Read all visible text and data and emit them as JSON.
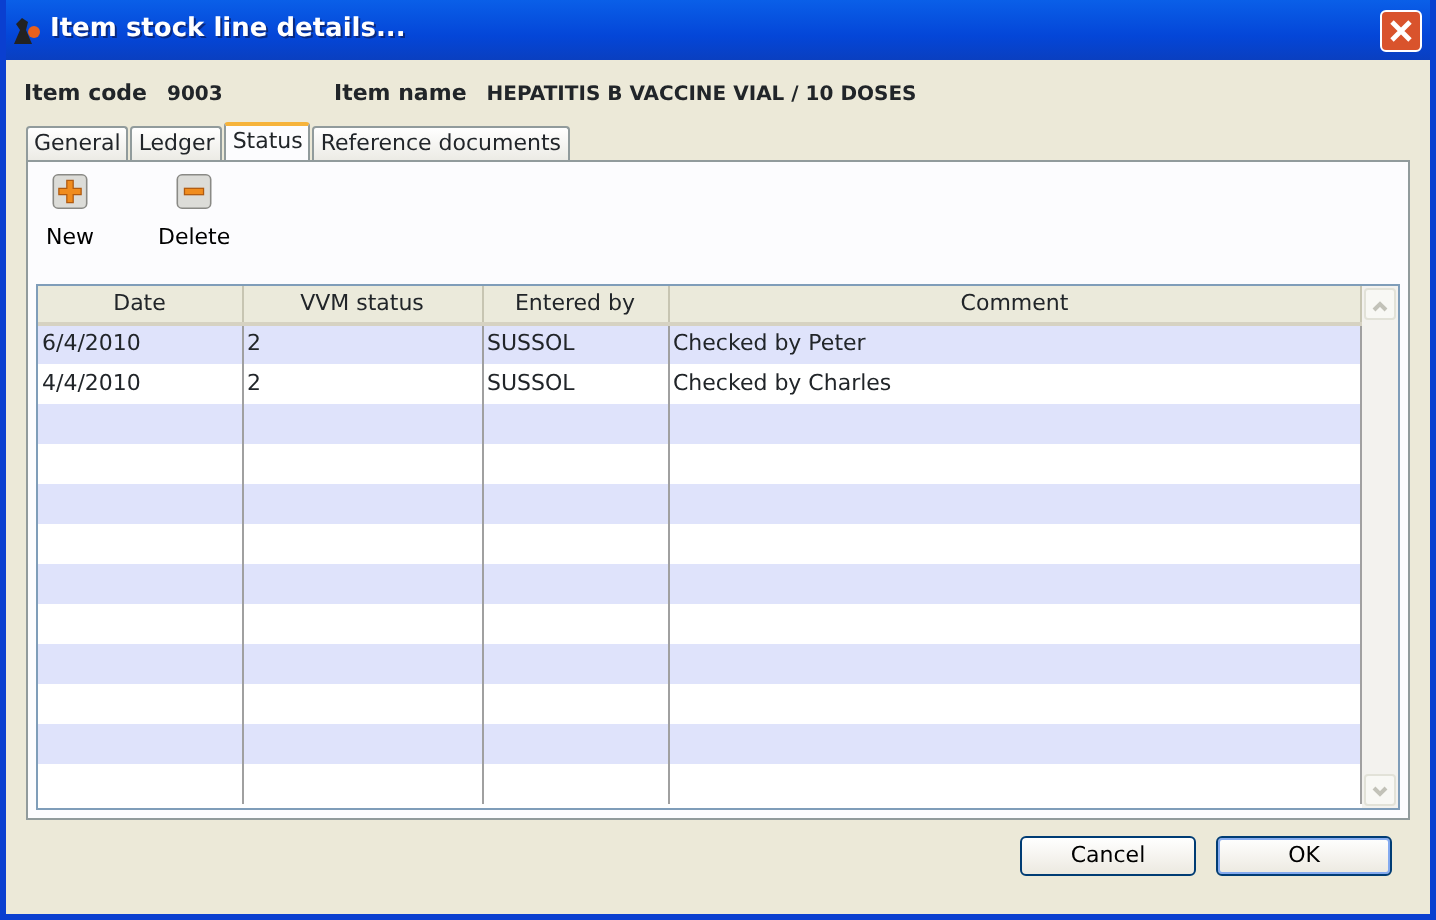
{
  "window": {
    "title": "Item stock line details..."
  },
  "fields": [
    {
      "label": "Item code",
      "value": "9003"
    },
    {
      "label": "Item name",
      "value": "HEPATITIS B VACCINE VIAL / 10 DOSES"
    }
  ],
  "tabs": [
    {
      "label": "General",
      "selected": false
    },
    {
      "label": "Ledger",
      "selected": false
    },
    {
      "label": "Status",
      "selected": true
    },
    {
      "label": "Reference documents",
      "selected": false
    }
  ],
  "toolbar": [
    {
      "kind": "add",
      "label": "New"
    },
    {
      "kind": "remove",
      "label": "Delete"
    }
  ],
  "table": {
    "columns": [
      "Date",
      "VVM status",
      "Entered by",
      "Comment"
    ],
    "rows": [
      [
        "6/4/2010",
        "2",
        "SUSSOL",
        "Checked by Peter"
      ],
      [
        "4/4/2010",
        "2",
        "SUSSOL",
        "Checked by Charles"
      ]
    ]
  },
  "buttons": [
    {
      "label": "Cancel",
      "default": false
    },
    {
      "label": "OK",
      "default": true
    }
  ]
}
